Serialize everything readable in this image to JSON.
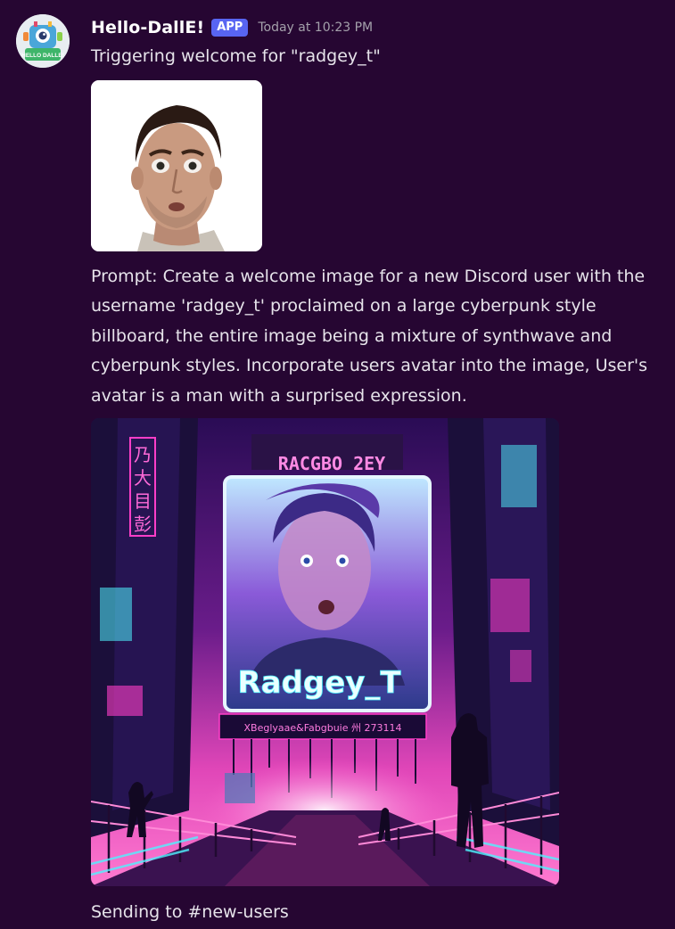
{
  "message": {
    "author": "Hello-DallE!",
    "app_tag": "APP",
    "timestamp": "Today at 10:23 PM",
    "avatar_label": "HELLO DALLE!",
    "line1": "Triggering welcome for \"radgey_t\"",
    "prompt": "Prompt: Create a welcome image for a new Discord user with the username 'radgey_t' proclaimed on a large cyberpunk style billboard, the entire image being a mixture of synthwave and cyberpunk styles. Incorporate users avatar into the image, User's avatar is a man with a surprised expression.",
    "footer": "Sending to #new-users"
  },
  "generated_image": {
    "billboard_header": "RACGBO 2EY",
    "billboard_name": "Radgey_T",
    "ticker_text": "XBeglyaae&Fabgbuie 州 273114",
    "neon_glyphs_left": [
      "乃",
      "大",
      "目",
      "彭"
    ]
  },
  "colors": {
    "background": "#260632",
    "app_tag": "#5865f2",
    "neon_pink": "#ff3ec8",
    "neon_cyan": "#4ff3ff"
  }
}
